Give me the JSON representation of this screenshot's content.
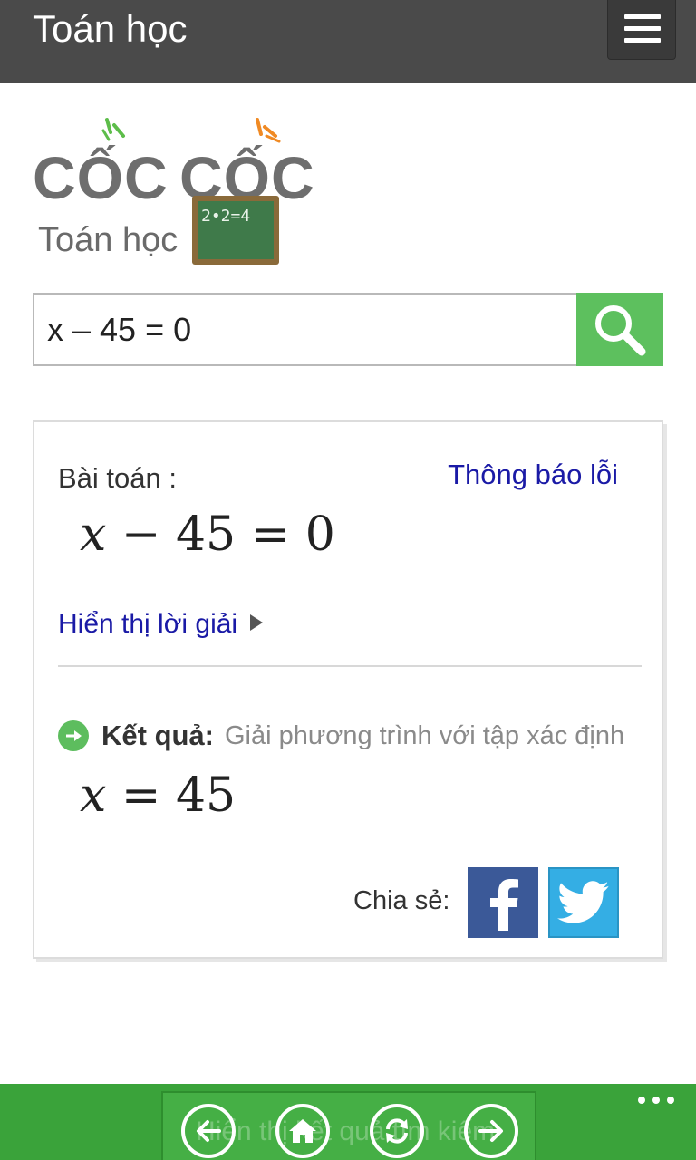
{
  "header": {
    "title": "Toán học",
    "menu_icon": "hamburger-icon"
  },
  "logo": {
    "brand_word_1": "CỐC",
    "brand_word_2": "CỐC",
    "subtitle": "Toán học",
    "chalkboard_text": "2•2=4",
    "brand_colors": {
      "spark_left": "#5dbd4a",
      "spark_right": "#f08a24",
      "text": "#6e6e6e"
    }
  },
  "search": {
    "value": "x – 45 = 0",
    "button_icon": "search-icon",
    "button_color": "#5dc05e"
  },
  "card": {
    "problem_label": "Bài toán :",
    "report_link": "Thông báo lỗi",
    "problem_expr": {
      "var": "x",
      "rest": " − 45 = 0"
    },
    "show_solution": "Hiển thị lời giải",
    "result_label": "Kết quả:",
    "result_desc": "Giải phương trình với tập xác định",
    "result_expr": {
      "var": "x",
      "rest": " = 45"
    },
    "share_label": "Chia sẻ:",
    "share_icons": [
      "facebook-icon",
      "twitter-icon"
    ]
  },
  "appbar": {
    "ghost_text": "Hiển thị kết quả tìm kiếm",
    "buttons": [
      "back-icon",
      "home-icon",
      "refresh-icon",
      "forward-icon"
    ],
    "accent": "#3aa33a"
  }
}
